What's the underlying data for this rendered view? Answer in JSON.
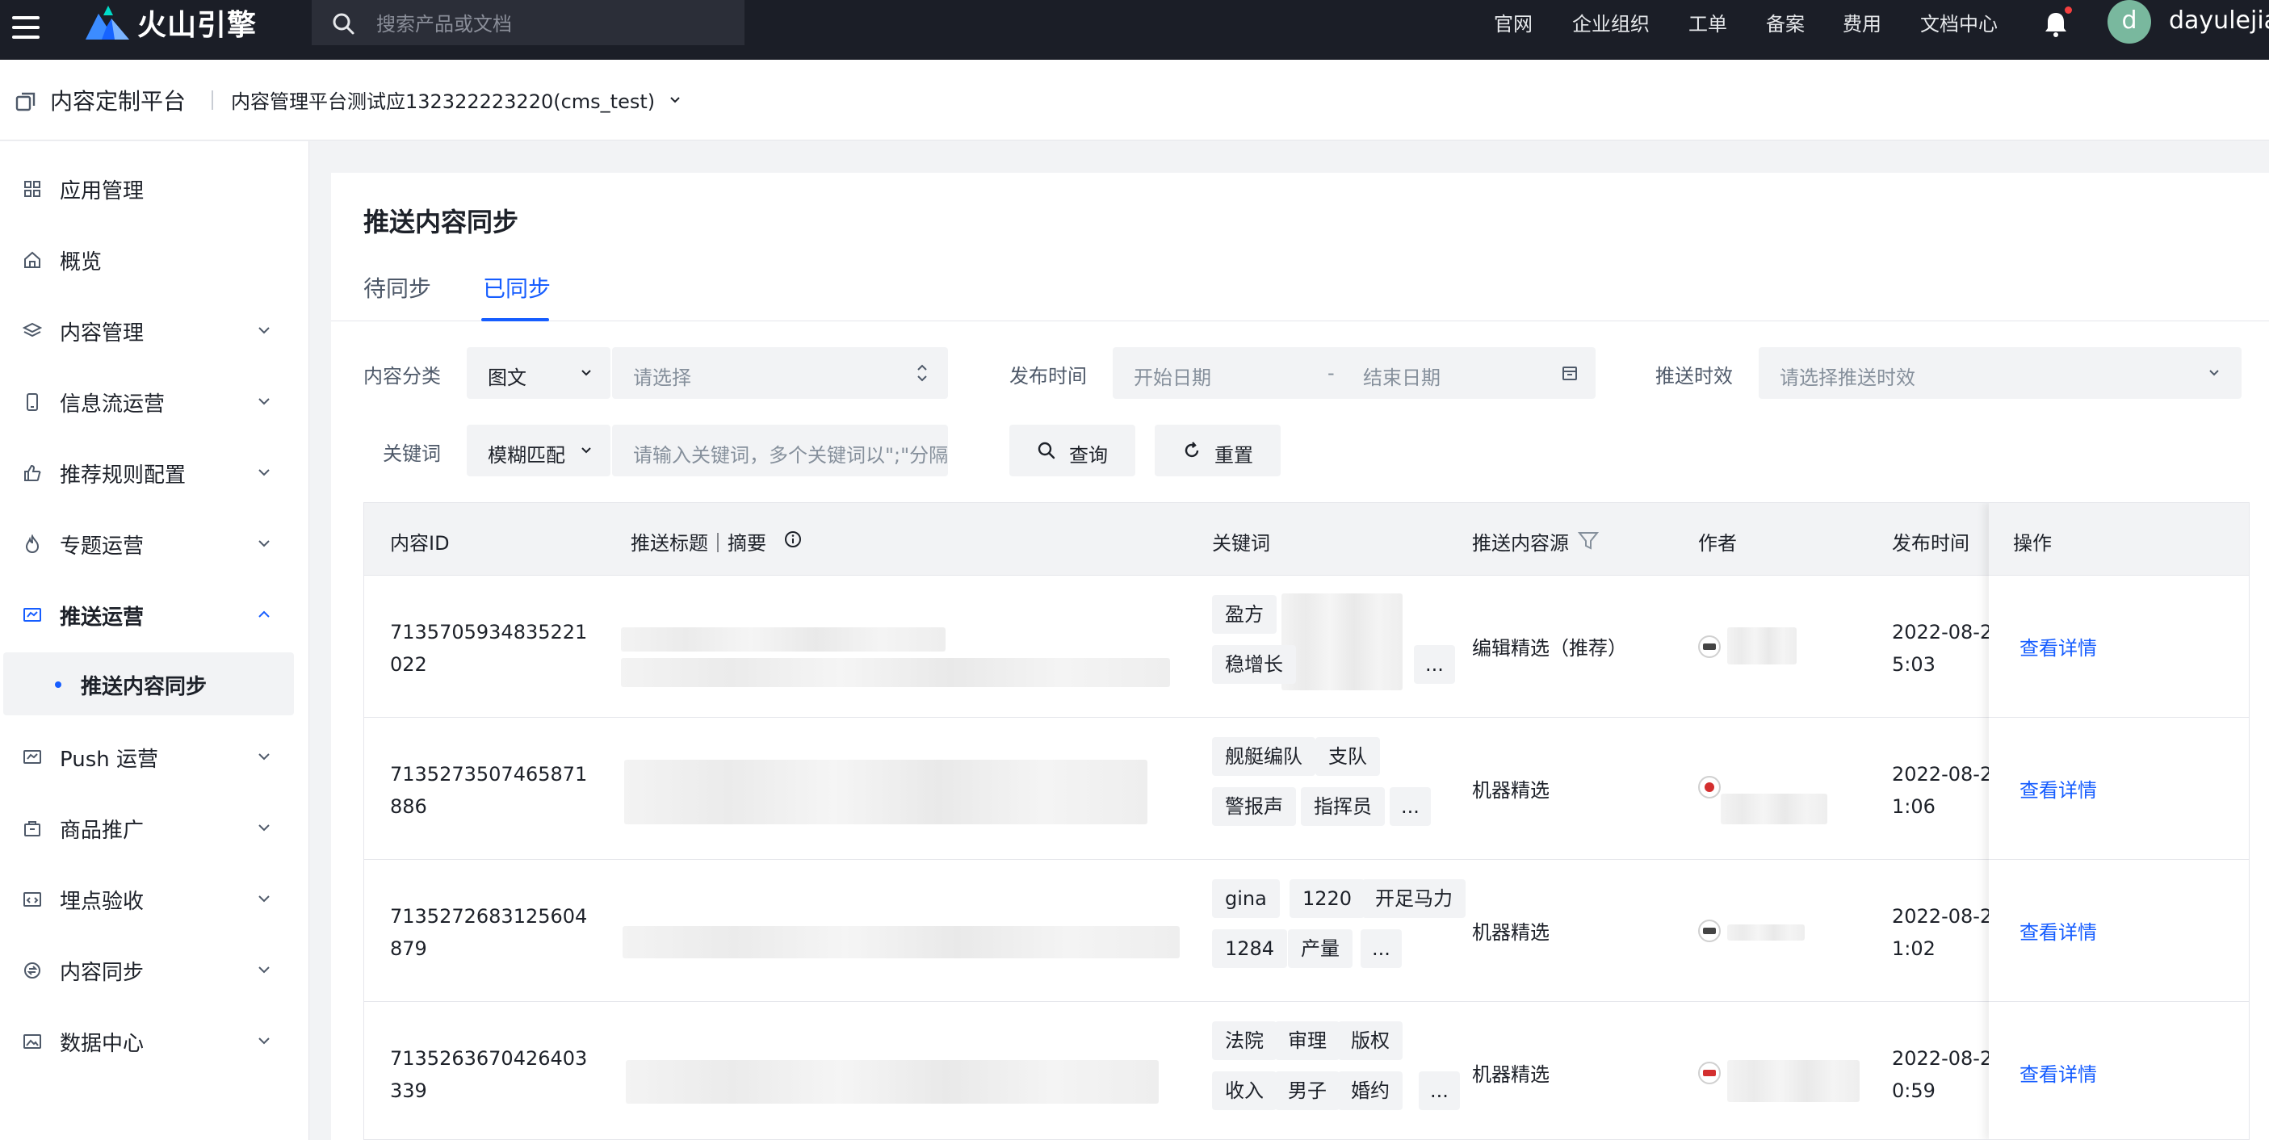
{
  "topbar": {
    "brand": "火山引擎",
    "search_placeholder": "搜索产品或文档",
    "nav": [
      "官网",
      "企业组织",
      "工单",
      "备案",
      "费用",
      "文档中心"
    ],
    "avatar_letter": "d",
    "username": "dayulejia"
  },
  "subbar": {
    "platform_title": "内容定制平台",
    "app_select": "内容管理平台测试应132322223220(cms_test)"
  },
  "sidebar": {
    "items": [
      {
        "label": "应用管理",
        "icon": "grid-icon"
      },
      {
        "label": "概览",
        "icon": "home-icon"
      },
      {
        "label": "内容管理",
        "icon": "layers-icon"
      },
      {
        "label": "信息流运营",
        "icon": "phone-icon"
      },
      {
        "label": "推荐规则配置",
        "icon": "thumb-up-icon"
      },
      {
        "label": "专题运营",
        "icon": "flame-icon"
      },
      {
        "label": "推送运营",
        "icon": "push-icon"
      },
      {
        "label": "Push 运营",
        "icon": "push-icon"
      },
      {
        "label": "商品推广",
        "icon": "bag-icon"
      },
      {
        "label": "埋点验收",
        "icon": "code-icon"
      },
      {
        "label": "内容同步",
        "icon": "sync-icon"
      },
      {
        "label": "数据中心",
        "icon": "image-icon"
      }
    ],
    "active_sub": "推送内容同步"
  },
  "page": {
    "title": "推送内容同步",
    "tabs": [
      "待同步",
      "已同步"
    ],
    "active_tab": "已同步"
  },
  "filters": {
    "category_label": "内容分类",
    "category_value": "图文",
    "category_sub_placeholder": "请选择",
    "publish_label": "发布时间",
    "start_placeholder": "开始日期",
    "date_sep": "-",
    "end_placeholder": "结束日期",
    "timeliness_label": "推送时效",
    "timeliness_placeholder": "请选择推送时效",
    "keyword_label": "关键词",
    "match_value": "模糊匹配",
    "keyword_placeholder": "请输入关键词，多个关键词以\";\"分隔",
    "query_button": "查询",
    "reset_button": "重置"
  },
  "table": {
    "headers": {
      "id": "内容ID",
      "title": "推送标题｜摘要",
      "keywords": "关键词",
      "source": "推送内容源",
      "author": "作者",
      "pubtime": "发布时间",
      "ops": "操作"
    },
    "rows": [
      {
        "id": "7135705934835221022",
        "tags": [
          "盈方",
          "稳增长",
          "..."
        ],
        "source": "编辑精选（推荐）",
        "pubtime": [
          "2022-08-2",
          "5:03"
        ],
        "op": "查看详情"
      },
      {
        "id": "7135273507465871886",
        "tags": [
          "舰艇编队",
          "支队",
          "警报声",
          "指挥员",
          "..."
        ],
        "source": "机器精选",
        "pubtime": [
          "2022-08-2",
          "1:06"
        ],
        "op": "查看详情"
      },
      {
        "id": "7135272683125604879",
        "tags": [
          "gina",
          "1220",
          "开足马力",
          "1284",
          "产量",
          "..."
        ],
        "source": "机器精选",
        "pubtime": [
          "2022-08-2",
          "1:02"
        ],
        "op": "查看详情"
      },
      {
        "id": "7135263670426403339",
        "tags": [
          "法院",
          "审理",
          "版权",
          "收入",
          "男子",
          "婚约",
          "..."
        ],
        "source": "机器精选",
        "pubtime": [
          "2022-08-2",
          "0:59"
        ],
        "op": "查看详情"
      }
    ]
  },
  "colors": {
    "topbar_bg": "#1b1e27",
    "accent": "#165dff",
    "notify_dot": "#f53f3f",
    "avatar_bg": "#79b89e"
  }
}
